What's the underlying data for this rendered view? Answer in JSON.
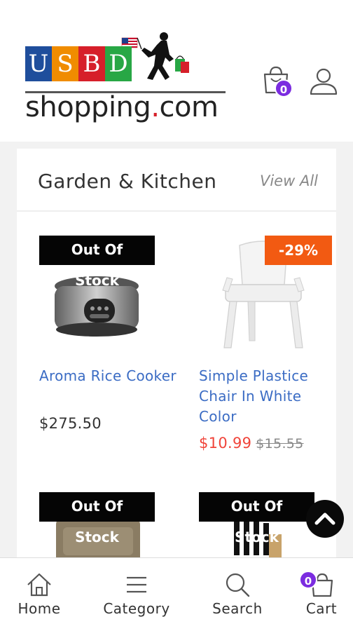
{
  "header": {
    "logo": {
      "letters": [
        "U",
        "S",
        "B",
        "D"
      ],
      "letter_colors": [
        "#1f4e9c",
        "#f08c00",
        "#d61f2a",
        "#28a745"
      ],
      "wordmark_pre": "shopping",
      "wordmark_dot": ".",
      "wordmark_post": "com"
    },
    "icons": {
      "cart": "shopping-bag-icon",
      "account": "user-icon"
    },
    "cart_count": "0"
  },
  "section": {
    "title": "Garden & Kitchen",
    "view_all": "View All"
  },
  "products": [
    {
      "name": "Aroma Rice Cooker",
      "badge_line1": "Out Of",
      "badge_line2": "Stock",
      "price": "$275.50"
    },
    {
      "name": "Simple Plastice Chair In White Color",
      "discount": "-29%",
      "sale_price": "$10.99",
      "old_price": "$15.55"
    },
    {
      "badge_line1": "Out Of",
      "badge_line2": "Stock"
    },
    {
      "badge_line1": "Out Of",
      "badge_line2": "Stock"
    }
  ],
  "bottom_nav": {
    "items": [
      {
        "label": "Home",
        "icon": "home-icon"
      },
      {
        "label": "Category",
        "icon": "menu-icon"
      },
      {
        "label": "Search",
        "icon": "search-icon"
      },
      {
        "label": "Cart",
        "icon": "cart-icon"
      }
    ],
    "cart_count": "0"
  },
  "colors": {
    "accent_purple": "#7b2ce0",
    "link_blue": "#3b6cc4",
    "discount_orange": "#f25a12",
    "sale_red": "#f0443a"
  }
}
